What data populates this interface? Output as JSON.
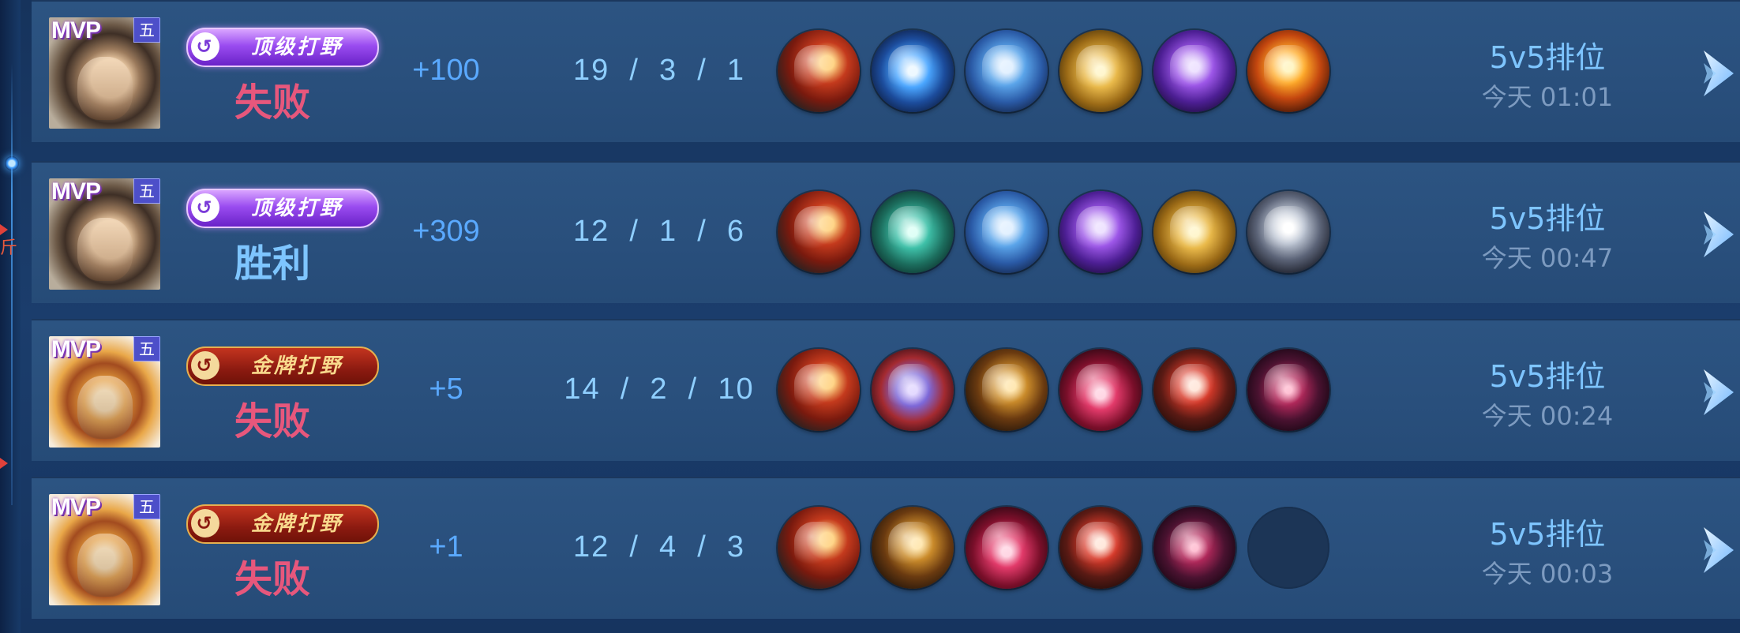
{
  "colors": {
    "lose": "#e7577c",
    "win": "#7ec5ff",
    "score": "#5aa9ff",
    "kda": "#8fcfff",
    "mode": "#7ec5ff",
    "time": "#7d9bc0"
  },
  "side": {
    "char": "斤"
  },
  "matches": [
    {
      "hero_icon": "hero-bearded-swordsman",
      "mvp_label": "MVP",
      "rank_badge": "五",
      "title": "顶级打野",
      "title_style": "purple",
      "result": "失败",
      "result_type": "lose",
      "score": "+100",
      "kda": "19  /  3  /  1",
      "items": [
        "red-gold-blade",
        "blue-winged-sword",
        "blue-axe",
        "gold-orb",
        "purple-axe",
        "fire-sword"
      ],
      "mode": "5v5排位",
      "time": "今天 01:01"
    },
    {
      "hero_icon": "hero-bearded-swordsman",
      "mvp_label": "MVP",
      "rank_badge": "五",
      "title": "顶级打野",
      "title_style": "purple",
      "result": "胜利",
      "result_type": "win",
      "score": "+309",
      "kda": "12  /  1  /  6",
      "items": [
        "red-gold-blade",
        "green-boots",
        "blue-axe",
        "purple-axe",
        "gold-orb",
        "silver-armor"
      ],
      "mode": "5v5排位",
      "time": "今天 00:47"
    },
    {
      "hero_icon": "hero-monkey-king",
      "mvp_label": "MVP",
      "rank_badge": "五",
      "title": "金牌打野",
      "title_style": "red",
      "result": "失败",
      "result_type": "lose",
      "score": "+5",
      "kda": "14  /  2  /  10",
      "items": [
        "red-gold-blade",
        "purple-gauntlet",
        "gold-spear",
        "crimson-wings",
        "red-helm",
        "dark-blade"
      ],
      "mode": "5v5排位",
      "time": "今天 00:24"
    },
    {
      "hero_icon": "hero-monkey-king",
      "mvp_label": "MVP",
      "rank_badge": "五",
      "title": "金牌打野",
      "title_style": "red",
      "result": "失败",
      "result_type": "lose",
      "score": "+1",
      "kda": "12  /  4  /  3",
      "items": [
        "red-gold-blade",
        "gold-spear",
        "crimson-wings",
        "red-helm",
        "dark-blade",
        "empty"
      ],
      "mode": "5v5排位",
      "time": "今天 00:03"
    }
  ]
}
